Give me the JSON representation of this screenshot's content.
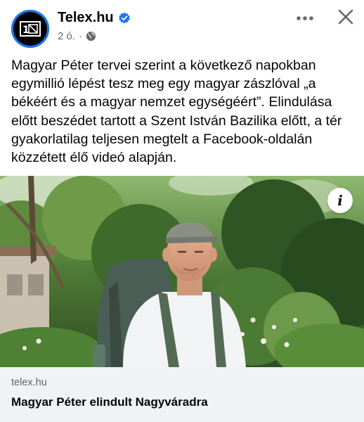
{
  "post": {
    "page_name": "Telex.hu",
    "time": "2 ó.",
    "separator": "·",
    "icons": {
      "avatar": "telex-logo-icon",
      "verified": "verified-badge-icon",
      "audience": "globe-icon",
      "more": "more-horizontal-icon",
      "close": "close-icon",
      "info": "info-icon"
    },
    "text": "Magyar Péter tervei szerint a következő napokban egymillió lépést tesz meg egy magyar zászlóval „a békéért és a magyar nemzet egységéért”. Elindulása előtt beszédet tartott a Szent István Bazilika előtt, a tér gyakorlatilag teljesen megtelt a Facebook-oldalán közzétett élő videó alapján.",
    "info_glyph": "i"
  },
  "link_card": {
    "domain": "telex.hu",
    "title": "Magyar Péter elindult Nagyváradra"
  },
  "colors": {
    "accent": "#1877f2",
    "secondary_text": "#65676b",
    "card_background": "#f0f2f5"
  }
}
